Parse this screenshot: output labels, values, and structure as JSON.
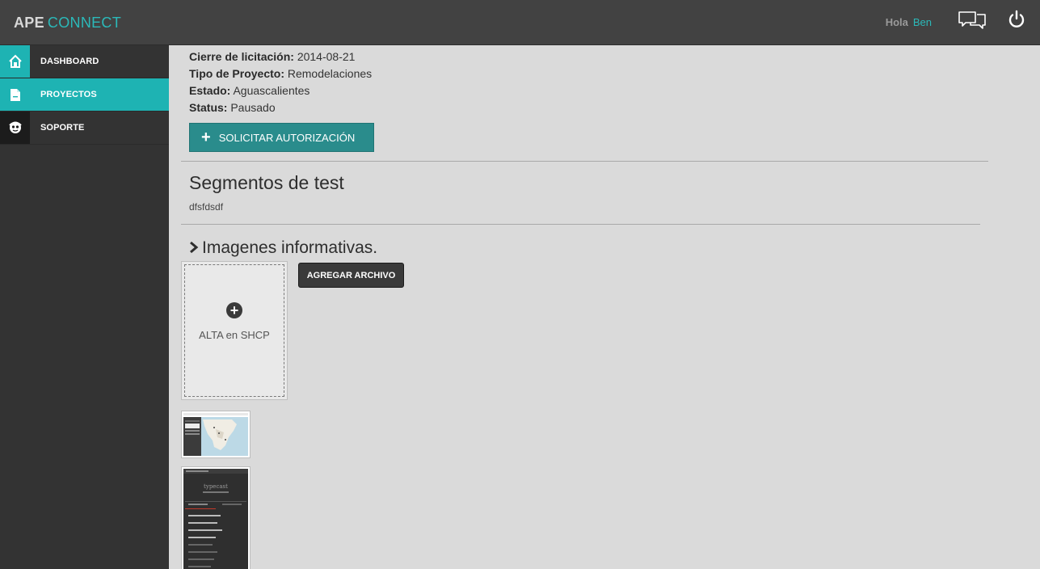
{
  "header": {
    "brand_bold": "APE",
    "brand_light": "CONNECT",
    "greeting": "Hola",
    "user_name": "Ben",
    "chat_icon": "chat-bubbles-icon",
    "power_icon": "power-icon"
  },
  "sidebar": {
    "items": [
      {
        "label": "DASHBOARD",
        "icon": "home-icon"
      },
      {
        "label": "PROYECTOS",
        "icon": "document-icon"
      },
      {
        "label": "SOPORTE",
        "icon": "support-avatar-icon"
      }
    ]
  },
  "project": {
    "fields": [
      {
        "label": "Cierre de licitación:",
        "value": "2014-08-21"
      },
      {
        "label": "Tipo de Proyecto:",
        "value": "Remodelaciones"
      },
      {
        "label": "Estado:",
        "value": "Aguascalientes"
      },
      {
        "label": "Status:",
        "value": "Pausado"
      }
    ],
    "auth_button": "SOLICITAR AUTORIZACIÓN"
  },
  "segments": {
    "title": "Segmentos de test",
    "description": "dfsfdsdf"
  },
  "images": {
    "title": "Imagenes informativas.",
    "upload_label": "ALTA en SHCP",
    "add_button": "AGREGAR ARCHIVO",
    "thumb2_title": "typecast"
  },
  "colors": {
    "accent": "#1eb3b3",
    "button_teal": "#2a8c8c",
    "topbar": "#424242",
    "sidebar": "#333333"
  }
}
